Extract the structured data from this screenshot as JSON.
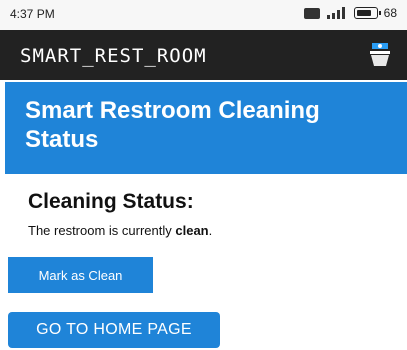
{
  "status_bar": {
    "time": "4:37 PM",
    "battery_level": "68"
  },
  "app_bar": {
    "title": "SMART_REST_ROOM",
    "logo_icon": "restroom-cleaning-icon"
  },
  "header": {
    "heading": "Smart Restroom Cleaning Status"
  },
  "status_section": {
    "title": "Cleaning Status:",
    "text_prefix": "The restroom is currently ",
    "status_value": "clean",
    "text_suffix": "."
  },
  "buttons": {
    "mark_clean_label": "Mark as Clean",
    "home_label": "GO TO HOME PAGE"
  },
  "colors": {
    "accent": "#1f84d8",
    "app_bar": "#222222"
  }
}
